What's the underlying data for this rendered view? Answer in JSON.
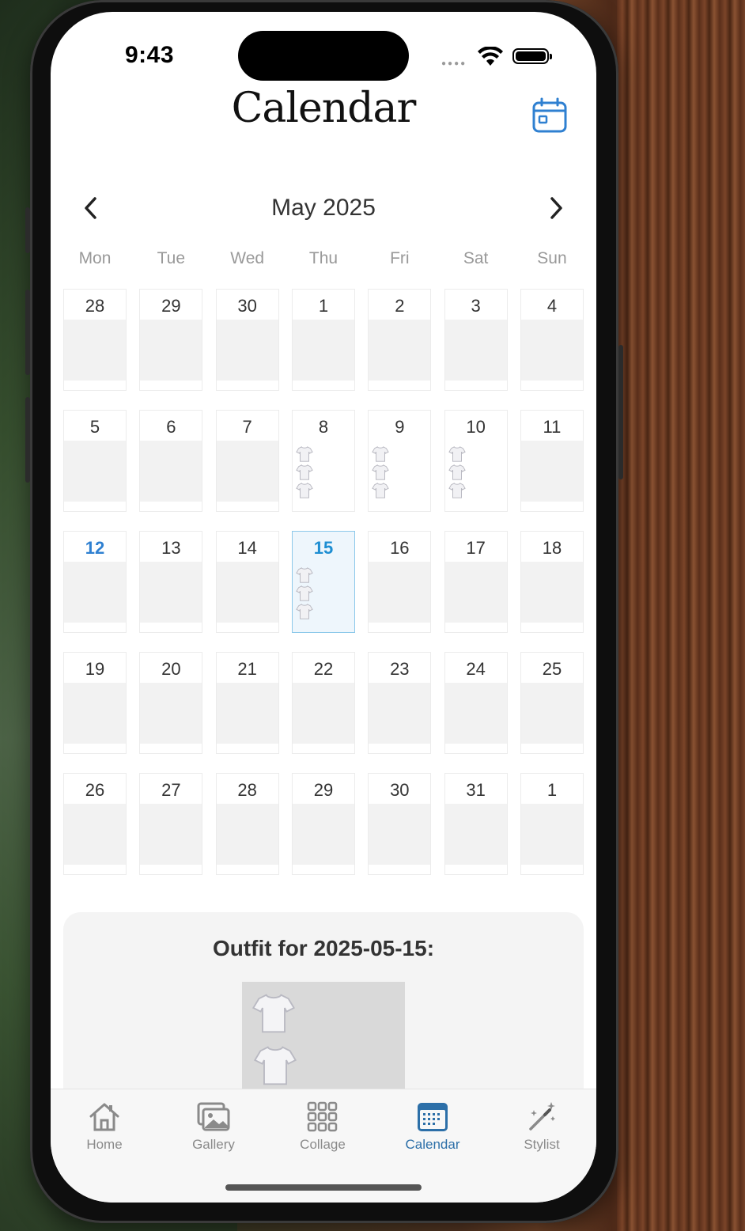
{
  "status_bar": {
    "time": "9:43"
  },
  "header": {
    "title": "Calendar",
    "calendar_button_icon": "calendar-icon"
  },
  "month_nav": {
    "label": "May 2025",
    "prev_icon": "chevron-left-icon",
    "next_icon": "chevron-right-icon"
  },
  "weekdays": [
    "Mon",
    "Tue",
    "Wed",
    "Thu",
    "Fri",
    "Sat",
    "Sun"
  ],
  "weeks": [
    [
      "28",
      "29",
      "30",
      "1",
      "2",
      "3",
      "4"
    ],
    [
      "5",
      "6",
      "7",
      "8",
      "9",
      "10",
      "11"
    ],
    [
      "12",
      "13",
      "14",
      "15",
      "16",
      "17",
      "18"
    ],
    [
      "19",
      "20",
      "21",
      "22",
      "23",
      "24",
      "25"
    ],
    [
      "26",
      "27",
      "28",
      "29",
      "30",
      "31",
      "1"
    ]
  ],
  "days_with_outfits": [
    "8",
    "9",
    "10",
    "15"
  ],
  "today": "12",
  "selected": "15",
  "outfit": {
    "title": "Outfit for 2025-05-15:"
  },
  "tabs": [
    {
      "label": "Home",
      "icon": "home-icon"
    },
    {
      "label": "Gallery",
      "icon": "gallery-icon"
    },
    {
      "label": "Collage",
      "icon": "collage-grid-icon"
    },
    {
      "label": "Calendar",
      "icon": "calendar-icon",
      "active": true
    },
    {
      "label": "Stylist",
      "icon": "magic-wand-icon"
    }
  ],
  "colors": {
    "accent": "#2f80d1",
    "selected_bg": "#eef6fc",
    "selected_border": "#8cc8ea",
    "cell_fill": "#f2f2f2"
  }
}
